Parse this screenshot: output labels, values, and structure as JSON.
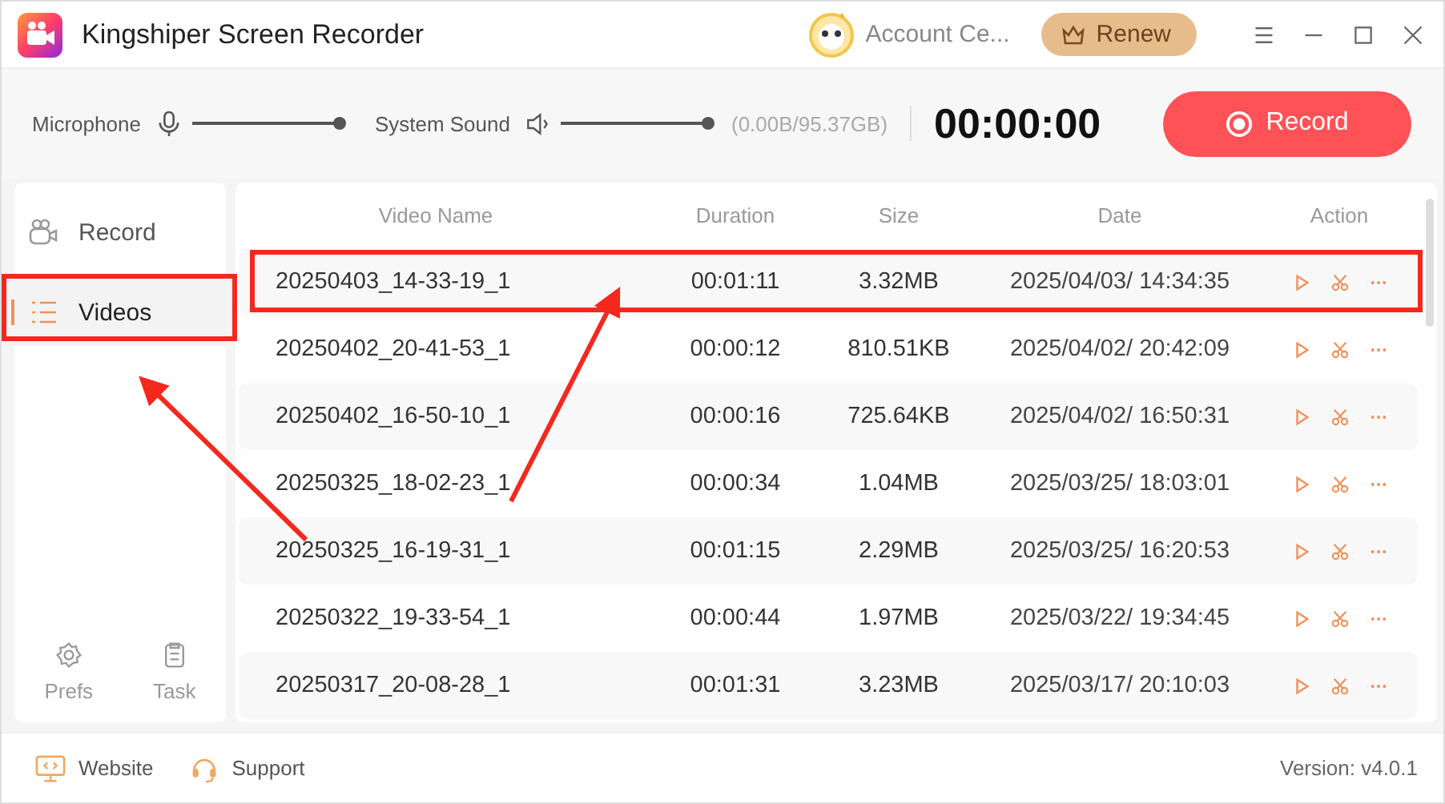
{
  "window": {
    "title": "Kingshiper Screen Recorder",
    "account": "Account Ce...",
    "renew": "Renew"
  },
  "toolbar": {
    "microphone": {
      "label": "Microphone",
      "level": 1
    },
    "system_sound": {
      "label": "System Sound",
      "level": 1
    },
    "storage": "(0.00B/95.37GB)",
    "timer": "00:00:00",
    "record_button": "Record"
  },
  "sidebar": {
    "items": [
      {
        "label": "Record",
        "selected": false
      },
      {
        "label": "Videos",
        "selected": true
      }
    ],
    "bottom": [
      {
        "label": "Prefs"
      },
      {
        "label": "Task"
      }
    ]
  },
  "table": {
    "columns": [
      "Video Name",
      "Duration",
      "Size",
      "Date",
      "Action"
    ],
    "rows": [
      {
        "name": "20250403_14-33-19_1",
        "duration": "00:01:11",
        "size": "3.32MB",
        "date": "2025/04/03/ 14:34:35"
      },
      {
        "name": "20250402_20-41-53_1",
        "duration": "00:00:12",
        "size": "810.51KB",
        "date": "2025/04/02/ 20:42:09"
      },
      {
        "name": "20250402_16-50-10_1",
        "duration": "00:00:16",
        "size": "725.64KB",
        "date": "2025/04/02/ 16:50:31"
      },
      {
        "name": "20250325_18-02-23_1",
        "duration": "00:00:34",
        "size": "1.04MB",
        "date": "2025/03/25/ 18:03:01"
      },
      {
        "name": "20250325_16-19-31_1",
        "duration": "00:01:15",
        "size": "2.29MB",
        "date": "2025/03/25/ 16:20:53"
      },
      {
        "name": "20250322_19-33-54_1",
        "duration": "00:00:44",
        "size": "1.97MB",
        "date": "2025/03/22/ 19:34:45"
      },
      {
        "name": "20250317_20-08-28_1",
        "duration": "00:01:31",
        "size": "3.23MB",
        "date": "2025/03/17/ 20:10:03"
      }
    ]
  },
  "status_bar": {
    "website": "Website",
    "support": "Support",
    "version": "Version: v4.0.1"
  }
}
